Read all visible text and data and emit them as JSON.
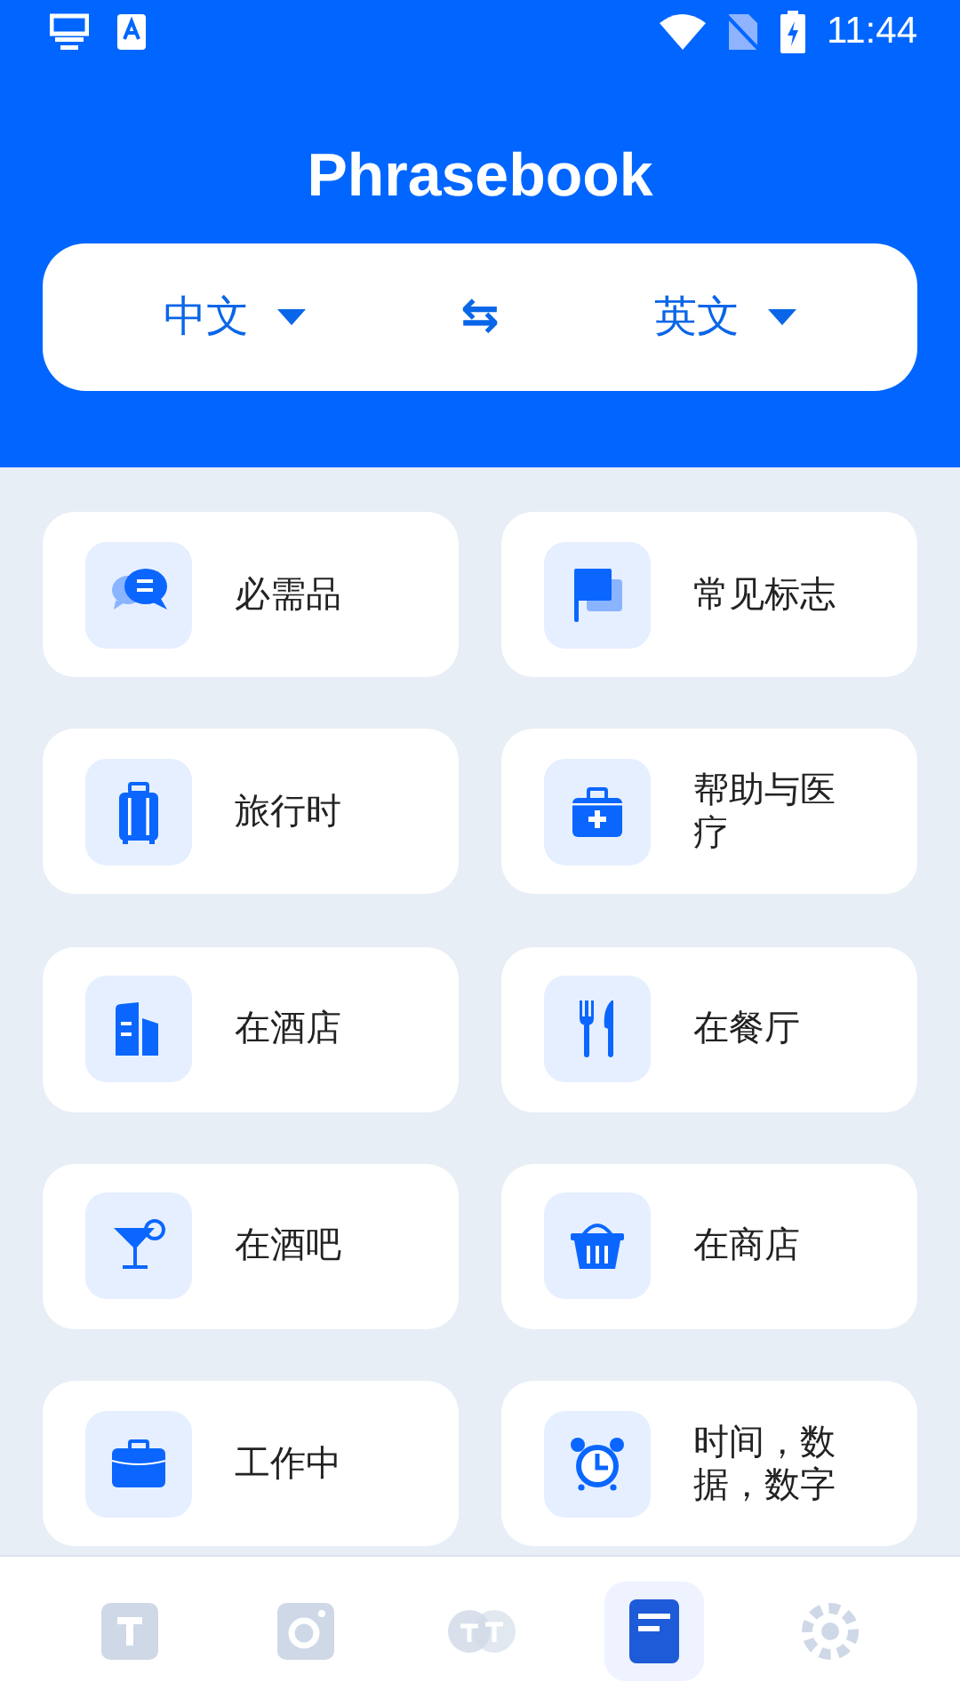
{
  "status_bar": {
    "time": "11:44"
  },
  "header": {
    "title": "Phrasebook"
  },
  "language_bar": {
    "source": "中文",
    "swap": "⇆",
    "target": "英文"
  },
  "categories": [
    {
      "label": "必需品",
      "kind": "chat"
    },
    {
      "label": "常见标志",
      "kind": "flag"
    },
    {
      "label": "旅行时",
      "kind": "luggage"
    },
    {
      "label": "帮助与医疗",
      "kind": "medical"
    },
    {
      "label": "在酒店",
      "kind": "building"
    },
    {
      "label": "在餐厅",
      "kind": "cutlery"
    },
    {
      "label": "在酒吧",
      "kind": "cocktail"
    },
    {
      "label": "在商店",
      "kind": "basket"
    },
    {
      "label": "工作中",
      "kind": "briefcase"
    },
    {
      "label": "时间，数据，数字",
      "kind": "alarm"
    }
  ],
  "bottom_nav": [
    {
      "kind": "text",
      "selected": false
    },
    {
      "kind": "camera",
      "selected": false
    },
    {
      "kind": "conversation",
      "selected": false
    },
    {
      "kind": "phrasebook",
      "selected": true
    },
    {
      "kind": "more",
      "selected": false
    }
  ]
}
